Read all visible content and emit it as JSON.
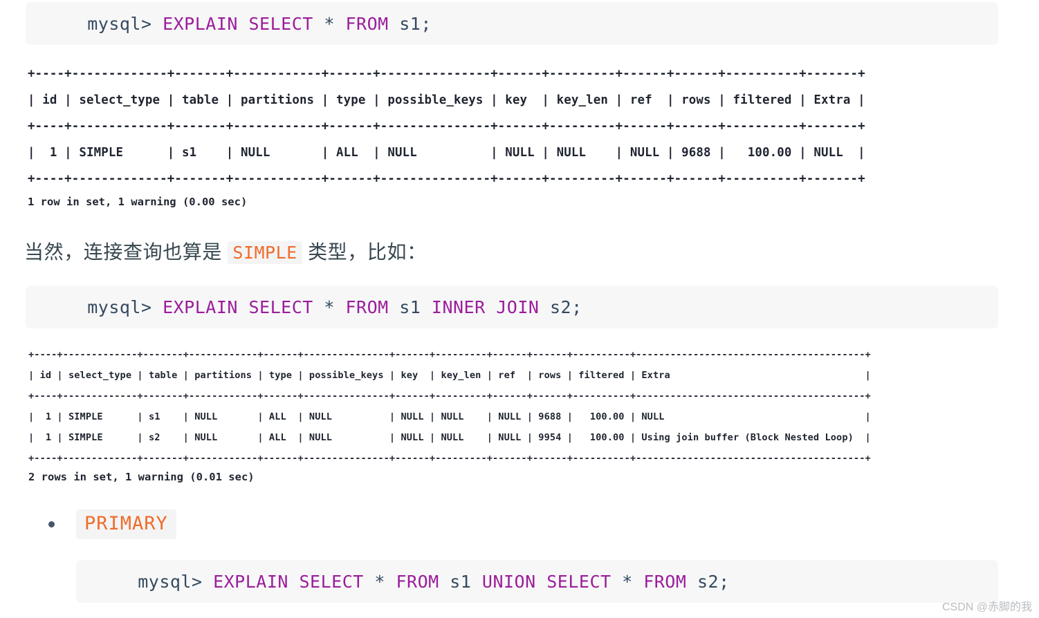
{
  "page": {
    "background": "#ffffff",
    "accent_keyword_color": "#9b1d9b",
    "accent_inline_code_color": "#ef6c2b",
    "code_block_bg": "#f7f7f8"
  },
  "blocks": {
    "query1": {
      "prompt": "mysql> ",
      "kw_explain": "EXPLAIN",
      "sp1": " ",
      "kw_select": "SELECT",
      "sp2": " * ",
      "kw_from": "FROM",
      "tail": " s1;"
    },
    "query2": {
      "prompt": "mysql> ",
      "kw_explain": "EXPLAIN",
      "sp1": " ",
      "kw_select": "SELECT",
      "sp2": " * ",
      "kw_from": "FROM",
      "mid": " s1 ",
      "kw_inner": "INNER",
      "sp3": " ",
      "kw_join": "JOIN",
      "tail": " s2;"
    },
    "query3": {
      "prompt": "mysql> ",
      "kw_explain": "EXPLAIN",
      "sp1": " ",
      "kw_select": "SELECT",
      "sp2": " * ",
      "kw_from": "FROM",
      "mid": " s1 ",
      "kw_union": "UNION",
      "sp3": " ",
      "kw_select2": "SELECT",
      "sp4": " * ",
      "kw_from2": "FROM",
      "tail": " s2;"
    }
  },
  "table1": {
    "columns": [
      "id",
      "select_type",
      "table",
      "partitions",
      "type",
      "possible_keys",
      "key",
      "key_len",
      "ref",
      "rows",
      "filtered",
      "Extra"
    ],
    "ascii": "+----+-------------+-------+------------+------+---------------+------+---------+------+------+----------+-------+\n| id | select_type | table | partitions | type | possible_keys | key  | key_len | ref  | rows | filtered | Extra |\n+----+-------------+-------+------------+------+---------------+------+---------+------+------+----------+-------+\n|  1 | SIMPLE      | s1    | NULL       | ALL  | NULL          | NULL | NULL    | NULL | 9688 |   100.00 | NULL  |\n+----+-------------+-------+------------+------+---------------+------+---------+------+------+----------+-------+",
    "rows": [
      {
        "id": "1",
        "select_type": "SIMPLE",
        "table": "s1",
        "partitions": "NULL",
        "type": "ALL",
        "possible_keys": "NULL",
        "key": "NULL",
        "key_len": "NULL",
        "ref": "NULL",
        "rows": "9688",
        "filtered": "100.00",
        "extra": "NULL"
      }
    ],
    "status": "1 row in set, 1 warning (0.00 sec)"
  },
  "table2": {
    "columns": [
      "id",
      "select_type",
      "table",
      "partitions",
      "type",
      "possible_keys",
      "key",
      "key_len",
      "ref",
      "rows",
      "filtered",
      "Extra"
    ],
    "ascii": "+----+-------------+-------+------------+------+---------------+------+---------+------+------+----------+----------------------------------------+\n| id | select_type | table | partitions | type | possible_keys | key  | key_len | ref  | rows | filtered | Extra                                  |\n+----+-------------+-------+------------+------+---------------+------+---------+------+------+----------+----------------------------------------+\n|  1 | SIMPLE      | s1    | NULL       | ALL  | NULL          | NULL | NULL    | NULL | 9688 |   100.00 | NULL                                   |\n|  1 | SIMPLE      | s2    | NULL       | ALL  | NULL          | NULL | NULL    | NULL | 9954 |   100.00 | Using join buffer (Block Nested Loop)  |\n+----+-------------+-------+------------+------+---------------+------+---------+------+------+----------+----------------------------------------+",
    "rows": [
      {
        "id": "1",
        "select_type": "SIMPLE",
        "table": "s1",
        "partitions": "NULL",
        "type": "ALL",
        "possible_keys": "NULL",
        "key": "NULL",
        "key_len": "NULL",
        "ref": "NULL",
        "rows": "9688",
        "filtered": "100.00",
        "extra": "NULL"
      },
      {
        "id": "1",
        "select_type": "SIMPLE",
        "table": "s2",
        "partitions": "NULL",
        "type": "ALL",
        "possible_keys": "NULL",
        "key": "NULL",
        "key_len": "NULL",
        "ref": "NULL",
        "rows": "9954",
        "filtered": "100.00",
        "extra": "Using join buffer (Block Nested Loop)"
      }
    ],
    "status": "2 rows in set, 1 warning (0.01 sec)"
  },
  "prose": {
    "before": "当然，连接查询也算是 ",
    "highlight": "SIMPLE",
    "after": " 类型，比如："
  },
  "bullet": {
    "label": "PRIMARY"
  },
  "watermark": {
    "text": "CSDN @赤脚的我"
  }
}
